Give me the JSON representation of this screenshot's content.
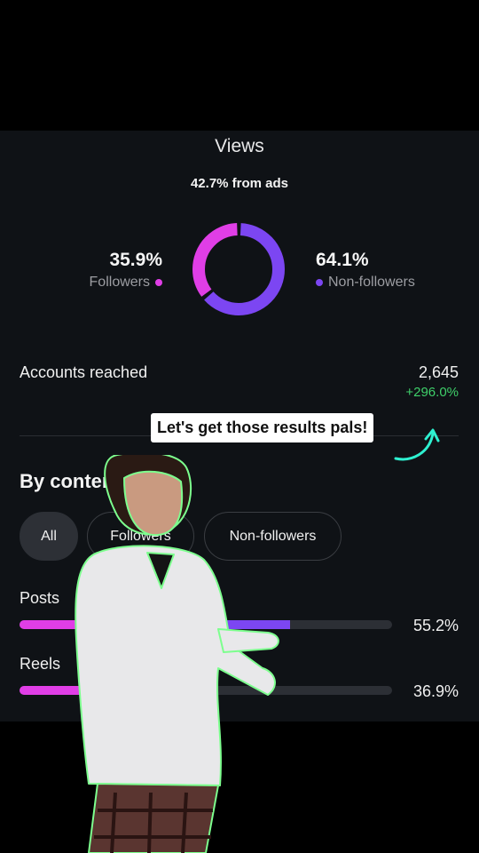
{
  "views": {
    "title": "Views",
    "ads_line": "42.7% from ads",
    "followers": {
      "pct": "35.9%",
      "label": "Followers",
      "value": 35.9
    },
    "non_followers": {
      "pct": "64.1%",
      "label": "Non-followers",
      "value": 64.1
    }
  },
  "colors": {
    "followers": "#e03ee6",
    "non_followers": "#7c46f2",
    "positive": "#3fcf6a"
  },
  "reach": {
    "label": "Accounts reached",
    "value": "2,645",
    "change": "+296.0%"
  },
  "overlay": {
    "caption": "Let's get those results pals!"
  },
  "by_content": {
    "title": "By content type",
    "chips": [
      {
        "label": "All",
        "selected": true
      },
      {
        "label": "Followers",
        "selected": false
      },
      {
        "label": "Non-followers",
        "selected": false
      }
    ],
    "rows": [
      {
        "label": "Posts",
        "pct_text": "55.2%",
        "value": 55.2,
        "followers_share": 0.35
      },
      {
        "label": "Reels",
        "pct_text": "36.9%",
        "value": 36.9,
        "followers_share": 0.36
      }
    ]
  }
}
